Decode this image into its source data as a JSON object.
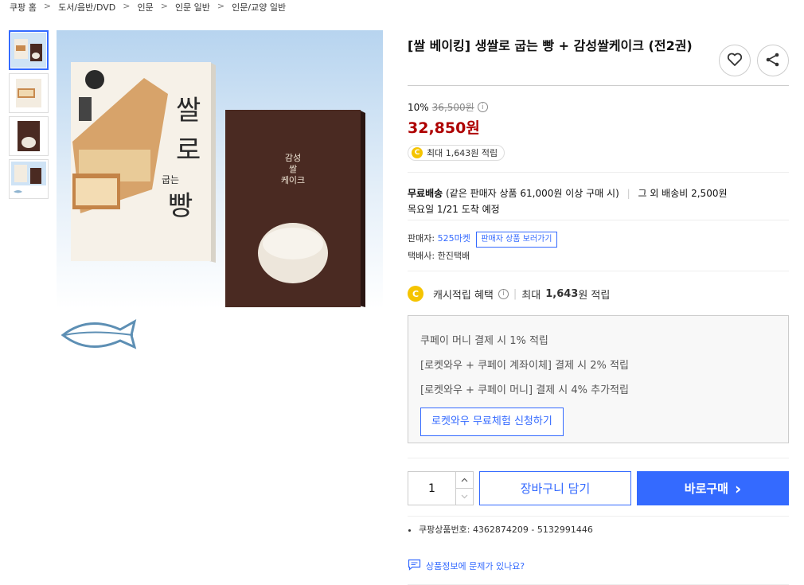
{
  "breadcrumb": {
    "items": [
      "쿠팡 홈",
      "도서/음반/DVD",
      "인문",
      "인문 일반",
      "인문/교양 일반"
    ],
    "separator": ">"
  },
  "product": {
    "title": "[쌀 베이킹] 생쌀로 굽는 빵 + 감성쌀케이크 (전2권)",
    "discount": "10%",
    "original_price": "36,500원",
    "sale_price": "32,850원",
    "cash_badge": "최대 1,643원 적립",
    "coin_letter": "C",
    "info_glyph": "i",
    "book1_title_lines": [
      "쌀",
      "로",
      "굽는",
      "빵"
    ],
    "book2_title_lines": [
      "감성",
      "쌀",
      "케이크"
    ]
  },
  "shipping": {
    "label": "무료배송",
    "condition": "(같은 판매자 상품 61,000원 이상 구매 시)",
    "other_fee": "그 외 배송비 2,500원",
    "arrival": "목요일 1/21 도착 예정"
  },
  "seller": {
    "label": "판매자:",
    "name": "525마켓",
    "button": "판매자 상품 보러가기",
    "courier_label": "택배사:",
    "courier": "한진택배"
  },
  "cashback": {
    "label": "캐시적립 혜택",
    "max_prefix": "최대",
    "max_amount": "1,643",
    "max_suffix": "원 적립"
  },
  "benefits": {
    "lines": [
      "쿠페이 머니 결제 시 1% 적립",
      "[로켓와우 + 쿠페이 계좌이체] 결제 시 2% 적립",
      "[로켓와우 + 쿠페이 머니] 결제 시 4% 추가적립"
    ],
    "trial_button": "로켓와우 무료체험 신청하기"
  },
  "purchase": {
    "quantity": "1",
    "cart_button": "장바구니 담기",
    "buy_button": "바로구매",
    "buy_arrow": "›"
  },
  "product_number": {
    "label": "쿠팡상품번호:",
    "value": "4362874209 - 5132991446"
  },
  "report_link": "상품정보에 문제가 있나요?",
  "colors": {
    "accent": "#346aff",
    "price_red": "#ae0000",
    "coin": "#f5c400"
  },
  "icons": [
    "heart-icon",
    "share-icon",
    "info-icon",
    "coin-icon",
    "chevron-up-icon",
    "chevron-down-icon",
    "chat-icon"
  ]
}
